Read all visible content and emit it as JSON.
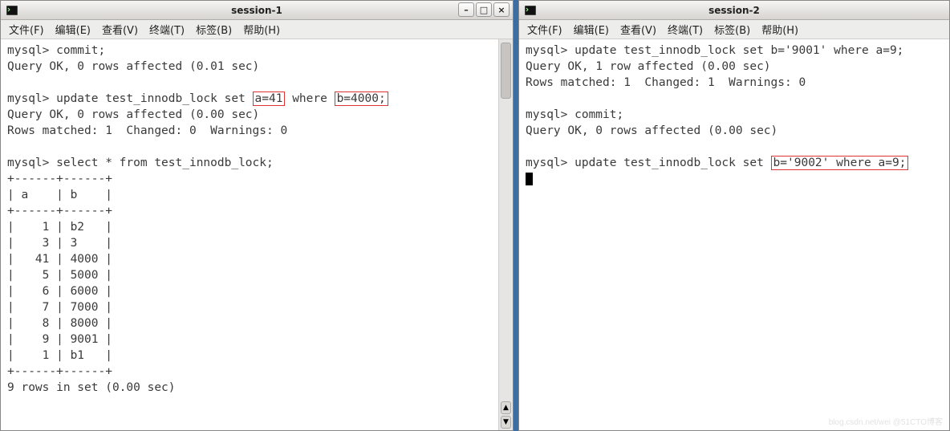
{
  "window1": {
    "title": "session-1",
    "menu": [
      "文件(F)",
      "编辑(E)",
      "查看(V)",
      "终端(T)",
      "标签(B)",
      "帮助(H)"
    ],
    "controls": {
      "min": "–",
      "max": "□",
      "close": "×"
    },
    "term": {
      "l0": "mysql> commit;",
      "l1": "Query OK, 0 rows affected (0.01 sec)",
      "l2": "",
      "l3a": "mysql> update test_innodb_lock set ",
      "l3b": "a=41",
      "l3c": " where ",
      "l3d": "b=4000;",
      "l4": "Query OK, 0 rows affected (0.00 sec)",
      "l5": "Rows matched: 1  Changed: 0  Warnings: 0",
      "l6": "",
      "l7": "mysql> select * from test_innodb_lock;",
      "l8": "+------+------+",
      "l9": "| a    | b    |",
      "l10": "+------+------+",
      "l11": "|    1 | b2   |",
      "l12": "|    3 | 3    |",
      "l13": "|   41 | 4000 |",
      "l14": "|    5 | 5000 |",
      "l15": "|    6 | 6000 |",
      "l16": "|    7 | 7000 |",
      "l17": "|    8 | 8000 |",
      "l18": "|    9 | 9001 |",
      "l19": "|    1 | b1   |",
      "l20": "+------+------+",
      "l21": "9 rows in set (0.00 sec)"
    }
  },
  "window2": {
    "title": "session-2",
    "menu": [
      "文件(F)",
      "编辑(E)",
      "查看(V)",
      "终端(T)",
      "标签(B)",
      "帮助(H)"
    ],
    "term": {
      "l0": "mysql> update test_innodb_lock set b='9001' where a=9;",
      "l1": "Query OK, 1 row affected (0.00 sec)",
      "l2": "Rows matched: 1  Changed: 1  Warnings: 0",
      "l3": "",
      "l4": "mysql> commit;",
      "l5": "Query OK, 0 rows affected (0.00 sec)",
      "l6": "",
      "l7a": "mysql> update test_innodb_lock set ",
      "l7b": "b='9002' where a=9;"
    }
  },
  "watermark": "blog.csdn.net/wei @51CTO博客"
}
